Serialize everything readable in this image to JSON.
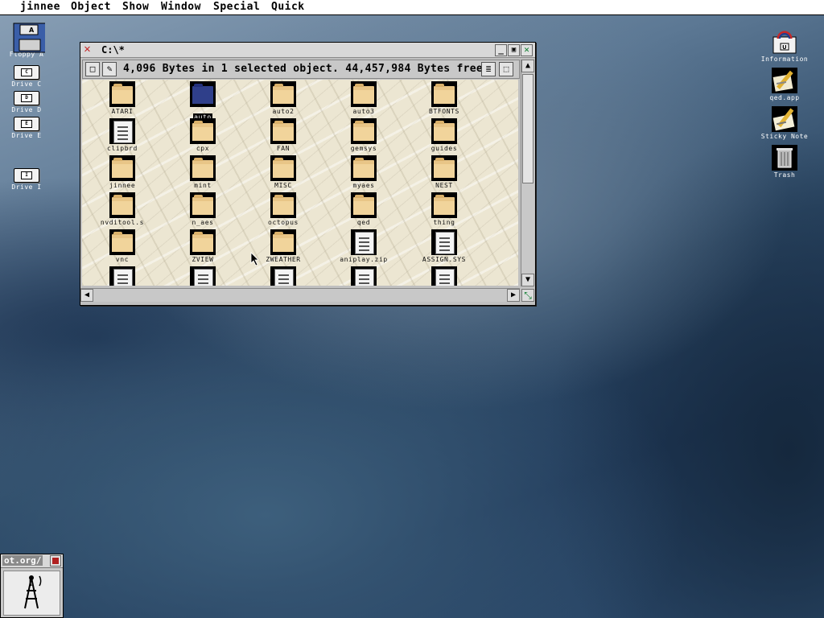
{
  "menubar": {
    "items": [
      "jinnee",
      "Object",
      "Show",
      "Window",
      "Special",
      "Quick"
    ]
  },
  "desktop_left": [
    {
      "label": "Floppy A",
      "letter": "A",
      "icon": "floppy-disk-icon"
    },
    {
      "label": "Drive C",
      "letter": "C",
      "icon": "hard-drive-icon"
    },
    {
      "label": "Drive D",
      "letter": "D",
      "icon": "hard-drive-icon"
    },
    {
      "label": "Drive E",
      "letter": "E",
      "icon": "hard-drive-icon"
    },
    {
      "label": "Drive I",
      "letter": "I",
      "icon": "hard-drive-icon"
    }
  ],
  "desktop_right": [
    {
      "label": "Information",
      "letter": "U",
      "icon": "information-icon"
    },
    {
      "label": "qed.app",
      "icon": "qed-app-icon"
    },
    {
      "label": "Sticky Note",
      "icon": "sticky-note-icon"
    },
    {
      "label": "Trash",
      "icon": "trash-icon"
    }
  ],
  "window": {
    "title": "C:\\*",
    "info": "4,096 Bytes in 1 selected object. 44,457,984 Bytes free.",
    "files": [
      {
        "name": "ATARI",
        "kind": "folder"
      },
      {
        "name": "auto",
        "kind": "folder",
        "selected": true
      },
      {
        "name": "auto2",
        "kind": "folder"
      },
      {
        "name": "auto3",
        "kind": "folder"
      },
      {
        "name": "BTFONTS",
        "kind": "folder"
      },
      {
        "name": "clipbrd",
        "kind": "doc"
      },
      {
        "name": "cpx",
        "kind": "folder"
      },
      {
        "name": "FAN",
        "kind": "folder"
      },
      {
        "name": "gemsys",
        "kind": "folder"
      },
      {
        "name": "guides",
        "kind": "folder"
      },
      {
        "name": "jinnee",
        "kind": "folder"
      },
      {
        "name": "mint",
        "kind": "folder"
      },
      {
        "name": "MISC",
        "kind": "folder"
      },
      {
        "name": "myaes",
        "kind": "folder"
      },
      {
        "name": "NEST",
        "kind": "folder"
      },
      {
        "name": "nvditool.s",
        "kind": "folder"
      },
      {
        "name": "n_aes",
        "kind": "folder"
      },
      {
        "name": "octopus",
        "kind": "folder"
      },
      {
        "name": "qed",
        "kind": "folder"
      },
      {
        "name": "thing",
        "kind": "folder"
      },
      {
        "name": "vnc",
        "kind": "folder"
      },
      {
        "name": "ZVIEW",
        "kind": "folder"
      },
      {
        "name": "ZWEATHER",
        "kind": "folder"
      },
      {
        "name": "aniplay.zip",
        "kind": "doc"
      },
      {
        "name": "ASSIGN.SYS",
        "kind": "doc"
      },
      {
        "name": "",
        "kind": "doc"
      },
      {
        "name": "",
        "kind": "doc"
      },
      {
        "name": "",
        "kind": "doc"
      },
      {
        "name": "",
        "kind": "doc"
      },
      {
        "name": "",
        "kind": "doc"
      }
    ]
  },
  "url_panel": {
    "text": "ot.org/"
  }
}
